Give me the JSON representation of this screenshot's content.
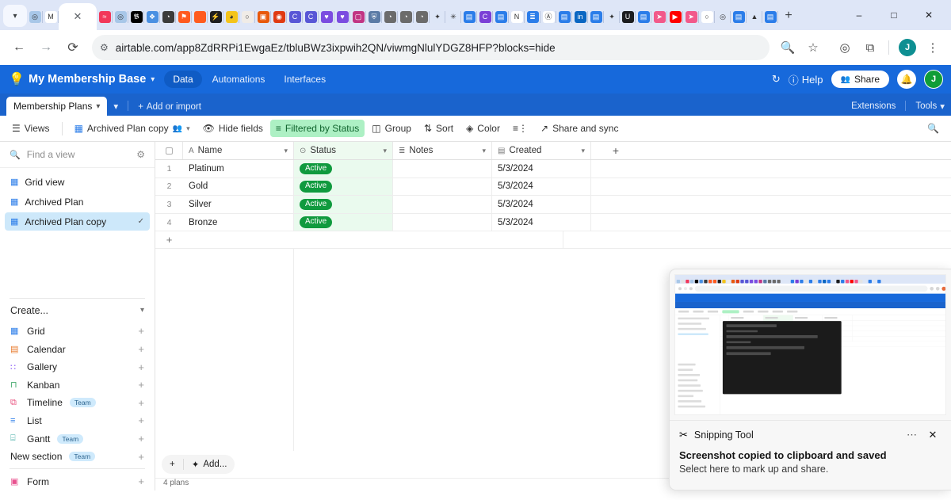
{
  "browser": {
    "tab_collapse_icon": "chevron-down-icon",
    "active_tab_close_icon": "close-icon",
    "new_tab_icon": "plus-icon",
    "window_controls": [
      {
        "name": "minimize-button",
        "glyph": "–"
      },
      {
        "name": "maximize-button",
        "glyph": "❐"
      },
      {
        "name": "close-window-button",
        "glyph": "✕"
      }
    ],
    "nav": {
      "back_icon": "back-arrow-icon",
      "forward_icon": "forward-arrow-icon",
      "reload_icon": "reload-icon"
    },
    "url": "airtable.com/app8ZdRRPi1EwgaEz/tbluBWz3ixpwih2QN/viwmgNlulYDGZ8HFP?blocks=hide",
    "site_info_icon": "site-settings-icon",
    "toolbar_icons": [
      "search-icon",
      "bookmark-star-icon",
      "screencast-icon",
      "extensions-icon"
    ],
    "profile_initial": "J",
    "menu_icon": "kebab-menu-icon",
    "pinned_favicons": [
      {
        "name": "chatgpt-tab",
        "color": "#a8c7e8",
        "glyph": "◎"
      },
      {
        "name": "gmail-tab",
        "color": "#ffffff",
        "glyph": "M"
      },
      {
        "name": "figma-tab",
        "color": "#f2385a",
        "glyph": "≈"
      },
      {
        "name": "chatgpt-tab-2",
        "color": "#a8c7e8",
        "glyph": "◎"
      },
      {
        "name": "x-twitter-tab",
        "color": "#000000",
        "glyph": "𝕭"
      },
      {
        "name": "slack-tab",
        "color": "#4a90e2",
        "glyph": "❖"
      },
      {
        "name": "browser-globe-tab",
        "color": "#3b3b3b",
        "glyph": "◔"
      },
      {
        "name": "flag-tab",
        "color": "#ff5a1f",
        "glyph": "⚑"
      },
      {
        "name": "orange-square-tab",
        "color": "#ff5b1e",
        "glyph": " "
      },
      {
        "name": "zap-tab",
        "color": "#1f1f1f",
        "glyph": "⚡"
      },
      {
        "name": "bell-yellow-tab",
        "color": "#f4c41a",
        "glyph": "◕"
      },
      {
        "name": "circle-tab",
        "color": "#f0ece7",
        "glyph": "○"
      },
      {
        "name": "box-tab",
        "color": "#e8590c",
        "glyph": "▣"
      },
      {
        "name": "red-app-tab",
        "color": "#e03a12",
        "glyph": "◉"
      },
      {
        "name": "claude-tab",
        "color": "#5856d6",
        "glyph": "C"
      },
      {
        "name": "claude-tab-2",
        "color": "#5856d6",
        "glyph": "C"
      },
      {
        "name": "heart-tab",
        "color": "#7b4ce0",
        "glyph": "♥"
      },
      {
        "name": "heart-tab-2",
        "color": "#7b4ce0",
        "glyph": "♥"
      },
      {
        "name": "instagram-tab",
        "color": "#c13584",
        "glyph": "▢"
      },
      {
        "name": "shield-tab",
        "color": "#5b7ba6",
        "glyph": "⛨"
      },
      {
        "name": "globe-gray-tab",
        "color": "#6b6b6b",
        "glyph": "◔"
      },
      {
        "name": "globe-gray-tab-2",
        "color": "#6b6b6b",
        "glyph": "◔"
      },
      {
        "name": "globe-gray-tab-3",
        "color": "#6b6b6b",
        "glyph": "◔"
      },
      {
        "name": "sparkle-tab",
        "color": "#dde6f7",
        "glyph": "✦"
      },
      {
        "name": "asterisk-tab",
        "color": "#dde6f7",
        "glyph": "✳"
      },
      {
        "name": "docs-tab",
        "color": "#2b7de9",
        "glyph": "▤"
      },
      {
        "name": "claude-tab-3",
        "color": "#7a3fd6",
        "glyph": "C"
      },
      {
        "name": "docs-tab-2",
        "color": "#2b7de9",
        "glyph": "▤"
      },
      {
        "name": "notion-tab",
        "color": "#ffffff",
        "glyph": "N"
      },
      {
        "name": "airtable-tab",
        "color": "#2b7de9",
        "glyph": "≣"
      },
      {
        "name": "amazon-tab",
        "color": "#ffffff",
        "glyph": "Ⓐ"
      },
      {
        "name": "docs-tab-3",
        "color": "#2b7de9",
        "glyph": "▤"
      },
      {
        "name": "linkedin-tab",
        "color": "#0a66c2",
        "glyph": "in"
      },
      {
        "name": "docs-tab-4",
        "color": "#2b7de9",
        "glyph": "▤"
      },
      {
        "name": "sparkle-tab-2",
        "color": "#dde6f7",
        "glyph": "✦"
      },
      {
        "name": "udemy-tab",
        "color": "#1c1d1f",
        "glyph": "U"
      },
      {
        "name": "docs-tab-5",
        "color": "#2b7de9",
        "glyph": "▤"
      },
      {
        "name": "pink-arrow-tab",
        "color": "#f2598a",
        "glyph": "➤"
      },
      {
        "name": "youtube-tab",
        "color": "#ff0000",
        "glyph": "▶"
      },
      {
        "name": "pink-arrow-tab-2",
        "color": "#f2598a",
        "glyph": "➤"
      },
      {
        "name": "white-circle-tab",
        "color": "#ffffff",
        "glyph": "○"
      },
      {
        "name": "teal-swirl-tab",
        "color": "#dde6f7",
        "glyph": "◎"
      },
      {
        "name": "docs-tab-6",
        "color": "#2b7de9",
        "glyph": "▤"
      },
      {
        "name": "google-drive-tab",
        "color": "#dde6f7",
        "glyph": "▲"
      },
      {
        "name": "docs-tab-7",
        "color": "#2b7de9",
        "glyph": "▤"
      }
    ]
  },
  "airtable": {
    "logo_icon": "airtable-bulb-icon",
    "base_name": "My Membership Base",
    "base_caret_icon": "chevron-down-icon",
    "nav": [
      {
        "label": "Data",
        "selected": true
      },
      {
        "label": "Automations",
        "selected": false
      },
      {
        "label": "Interfaces",
        "selected": false
      }
    ],
    "history_icon": "history-clock-icon",
    "help_label": "Help",
    "help_icon": "help-circle-icon",
    "share_label": "Share",
    "share_icon": "share-people-icon",
    "notification_icon": "bell-icon",
    "avatar_initial": "J",
    "table_tab": {
      "label": "Membership Plans",
      "caret_icon": "chevron-down-icon"
    },
    "tabs_caret_icon": "chevron-down-icon",
    "add_or_import": "Add or import",
    "add_icon": "plus-icon",
    "extensions_label": "Extensions",
    "tools_label": "Tools",
    "tools_caret_icon": "chevron-down-icon"
  },
  "viewbar": {
    "views_label": "Views",
    "views_icon": "hamburger-icon",
    "current_view": "Archived Plan copy",
    "current_view_icon": "grid-view-icon",
    "current_view_people_icon": "collaborators-icon",
    "current_view_caret_icon": "chevron-down-icon",
    "hide_fields_label": "Hide fields",
    "hide_fields_icon": "eye-slash-icon",
    "filter_label": "Filtered by Status",
    "filter_icon": "filter-icon",
    "group_label": "Group",
    "group_icon": "group-icon",
    "sort_label": "Sort",
    "sort_icon": "sort-icon",
    "color_label": "Color",
    "color_icon": "paint-drop-icon",
    "row_height_icon": "row-height-icon",
    "share_sync_label": "Share and sync",
    "share_sync_icon": "external-link-icon",
    "search_icon": "search-icon"
  },
  "sidebar": {
    "search_placeholder": "Find a view",
    "search_icon": "search-icon",
    "settings_icon": "gear-icon",
    "views": [
      {
        "label": "Grid view",
        "icon": "grid-view-icon",
        "active": false,
        "check": ""
      },
      {
        "label": "Archived Plan",
        "icon": "grid-view-icon",
        "active": false,
        "check": ""
      },
      {
        "label": "Archived Plan copy",
        "icon": "grid-view-icon",
        "active": true,
        "check": "✓"
      }
    ],
    "create_label": "Create...",
    "create_caret_icon": "chevron-down-icon",
    "create_items": [
      {
        "label": "Grid",
        "icon": "grid-icon",
        "color": "#2b7de9",
        "glyph": "▦",
        "badge": ""
      },
      {
        "label": "Calendar",
        "icon": "calendar-icon",
        "color": "#e8792b",
        "glyph": "▤",
        "badge": ""
      },
      {
        "label": "Gallery",
        "icon": "gallery-icon",
        "color": "#8b5cf6",
        "glyph": "∷",
        "badge": ""
      },
      {
        "label": "Kanban",
        "icon": "kanban-icon",
        "color": "#3fa76a",
        "glyph": "⊓",
        "badge": ""
      },
      {
        "label": "Timeline",
        "icon": "timeline-icon",
        "color": "#e8527f",
        "glyph": "⧉",
        "badge": "Team"
      },
      {
        "label": "List",
        "icon": "list-icon",
        "color": "#2b7de9",
        "glyph": "≡",
        "badge": ""
      },
      {
        "label": "Gantt",
        "icon": "gantt-icon",
        "color": "#3aa8a0",
        "glyph": "⌸",
        "badge": "Team"
      },
      {
        "label": "New section",
        "icon": "",
        "color": "",
        "glyph": "",
        "badge": "Team"
      }
    ],
    "form_item": {
      "label": "Form",
      "icon": "form-icon",
      "color": "#e8528f",
      "glyph": "▣",
      "badge": ""
    },
    "plus_icon": "plus-icon"
  },
  "grid": {
    "select_all_icon": "checkbox-icon",
    "add_field_icon": "plus-icon",
    "add_row_icon": "plus-icon",
    "columns": [
      {
        "label": "Name",
        "icon": "text-field-icon",
        "glyph": "A",
        "caret": "⌄"
      },
      {
        "label": "Status",
        "icon": "single-select-icon",
        "glyph": "⊙",
        "caret": "⌄"
      },
      {
        "label": "Notes",
        "icon": "long-text-icon",
        "glyph": "≣",
        "caret": "⌄"
      },
      {
        "label": "Created",
        "icon": "created-time-icon",
        "glyph": "▤",
        "caret": "⌄"
      }
    ],
    "rows": [
      {
        "num": "1",
        "name": "Platinum",
        "status": "Active",
        "notes": "",
        "created": "5/3/2024"
      },
      {
        "num": "2",
        "name": "Gold",
        "status": "Active",
        "notes": "",
        "created": "5/3/2024"
      },
      {
        "num": "3",
        "name": "Silver",
        "status": "Active",
        "notes": "",
        "created": "5/3/2024"
      },
      {
        "num": "4",
        "name": "Bronze",
        "status": "Active",
        "notes": "",
        "created": "5/3/2024"
      }
    ],
    "add_button_label": "Add...",
    "add_button_icon": "magic-wand-icon",
    "add_plus_icon": "plus-icon",
    "record_count": "4 plans",
    "status_badge_color": "#109a3e",
    "status_column_tint": "#eafaee"
  },
  "toast": {
    "app_name": "Snipping Tool",
    "app_icon": "snipping-tool-icon",
    "more_icon": "more-options-icon",
    "close_icon": "close-icon",
    "title": "Screenshot copied to clipboard and saved",
    "subtitle": "Select here to mark up and share."
  },
  "colors": {
    "airtable_blue": "#1769db",
    "airtable_blue_dark": "#1a63cc",
    "filter_green_bg": "#adf0c4",
    "filter_green_text": "#10652e",
    "active_badge": "#109a3e",
    "sidebar_active": "#cde8fa",
    "tabstrip": "#dee6f7"
  }
}
